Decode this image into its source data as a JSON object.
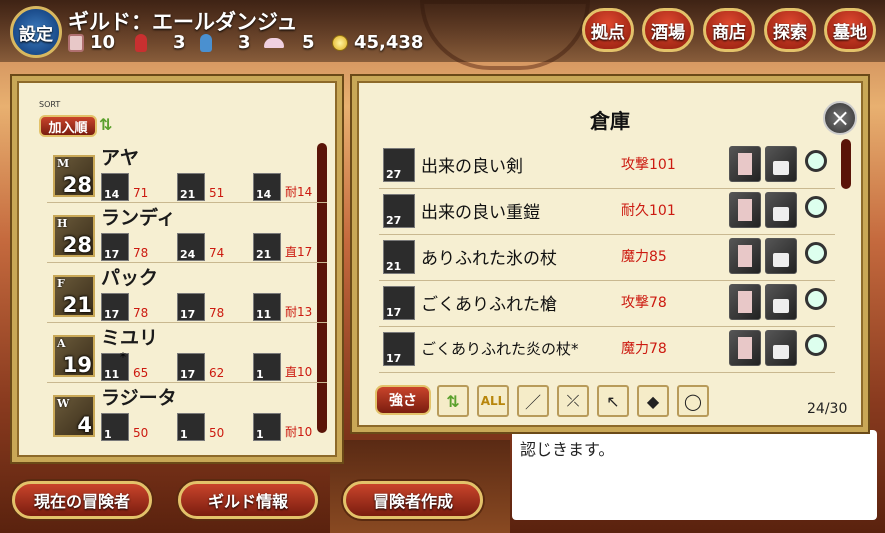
{
  "header": {
    "settings_label": "設定",
    "guild_name": "ギルド：エールダンジュ",
    "resources": [
      {
        "icon": "scroll-icon",
        "value": "10",
        "color": "#d9a0a0"
      },
      {
        "icon": "red-potion-icon",
        "value": "3",
        "color": "#c83030"
      },
      {
        "icon": "blue-potion-icon",
        "value": "3",
        "color": "#4a90d0"
      },
      {
        "icon": "crown-icon",
        "value": "5",
        "color": "#e8b0d0"
      }
    ],
    "gold": "45,438"
  },
  "nav": [
    "拠点",
    "酒場",
    "商店",
    "探索",
    "墓地"
  ],
  "party": {
    "sort_small": "SORT",
    "sort_btn": "加入順",
    "members": [
      {
        "cls": "M",
        "level": "28",
        "name": "アヤ",
        "eq": [
          {
            "n": "14",
            "v": "71"
          },
          {
            "n": "21",
            "v": "51"
          },
          {
            "n": "14",
            "v": "耐14"
          }
        ]
      },
      {
        "cls": "H",
        "level": "28",
        "name": "ランディ",
        "eq": [
          {
            "n": "17",
            "v": "78"
          },
          {
            "n": "24",
            "v": "74"
          },
          {
            "n": "21",
            "v": "直17"
          }
        ]
      },
      {
        "cls": "F",
        "level": "21",
        "name": "パック",
        "eq": [
          {
            "n": "17",
            "v": "78"
          },
          {
            "n": "17",
            "v": "78"
          },
          {
            "n": "11",
            "v": "耐13"
          }
        ]
      },
      {
        "cls": "A",
        "level": "19",
        "name": "ミユリ",
        "eq": [
          {
            "n": "11",
            "v": "65",
            "x": "*"
          },
          {
            "n": "17",
            "v": "62"
          },
          {
            "n": "1",
            "v": "直10"
          }
        ]
      },
      {
        "cls": "W",
        "level": "4",
        "name": "ラジータ",
        "eq": [
          {
            "n": "1",
            "v": "50"
          },
          {
            "n": "1",
            "v": "50"
          },
          {
            "n": "1",
            "v": "耐10"
          }
        ]
      }
    ]
  },
  "storage": {
    "title": "倉庫",
    "items": [
      {
        "n": "27",
        "name": "出来の良い剣",
        "stat": "攻撃101"
      },
      {
        "n": "27",
        "name": "出来の良い重鎧",
        "stat": "耐久101"
      },
      {
        "n": "21",
        "name": "ありふれた氷の杖",
        "stat": "魔力85"
      },
      {
        "n": "17",
        "name": "ごくありふれた槍",
        "stat": "攻撃78"
      },
      {
        "n": "17",
        "name": "ごくありふれた炎の杖*",
        "stat": "魔力78"
      }
    ],
    "sort_btn": "強さ",
    "all_label": "ALL",
    "count": "24/30"
  },
  "bottom": {
    "btn_current": "現在の冒険者",
    "btn_guild": "ギルド情報",
    "btn_create": "冒険者作成",
    "dialog_text": "認じきます。"
  }
}
